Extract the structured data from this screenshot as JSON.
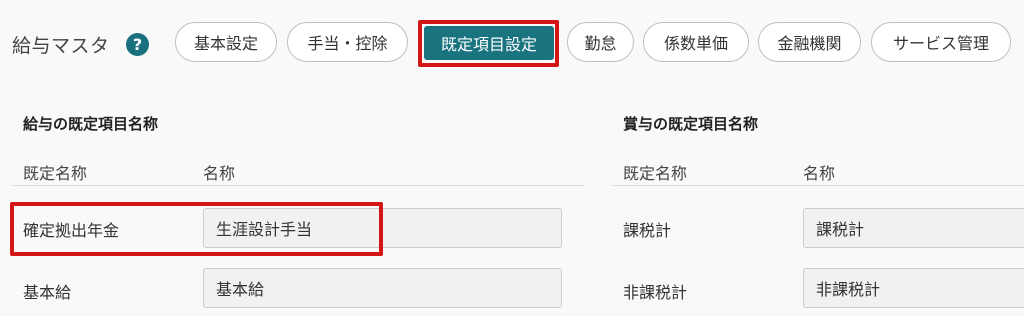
{
  "header": {
    "title": "給与マスタ",
    "help_icon": "?",
    "tabs": [
      {
        "label": "基本設定",
        "active": false
      },
      {
        "label": "手当・控除",
        "active": false
      },
      {
        "label": "既定項目設定",
        "active": true
      },
      {
        "label": "勤怠",
        "active": false
      },
      {
        "label": "係数単価",
        "active": false
      },
      {
        "label": "金融機関",
        "active": false
      },
      {
        "label": "サービス管理",
        "active": false
      }
    ]
  },
  "salary": {
    "title": "給与の既定項目名称",
    "col_default": "既定名称",
    "col_name": "名称",
    "rows": [
      {
        "default_name": "確定拠出年金",
        "name": "生涯設計手当"
      },
      {
        "default_name": "基本給",
        "name": "基本給"
      }
    ]
  },
  "bonus": {
    "title": "賞与の既定項目名称",
    "col_default": "既定名称",
    "col_name": "名称",
    "rows": [
      {
        "default_name": "課税計",
        "name": "課税計"
      },
      {
        "default_name": "非課税計",
        "name": "非課税計"
      }
    ]
  },
  "colors": {
    "accent": "#1a7480",
    "highlight": "#d31515",
    "background": "#f9f9f9"
  }
}
